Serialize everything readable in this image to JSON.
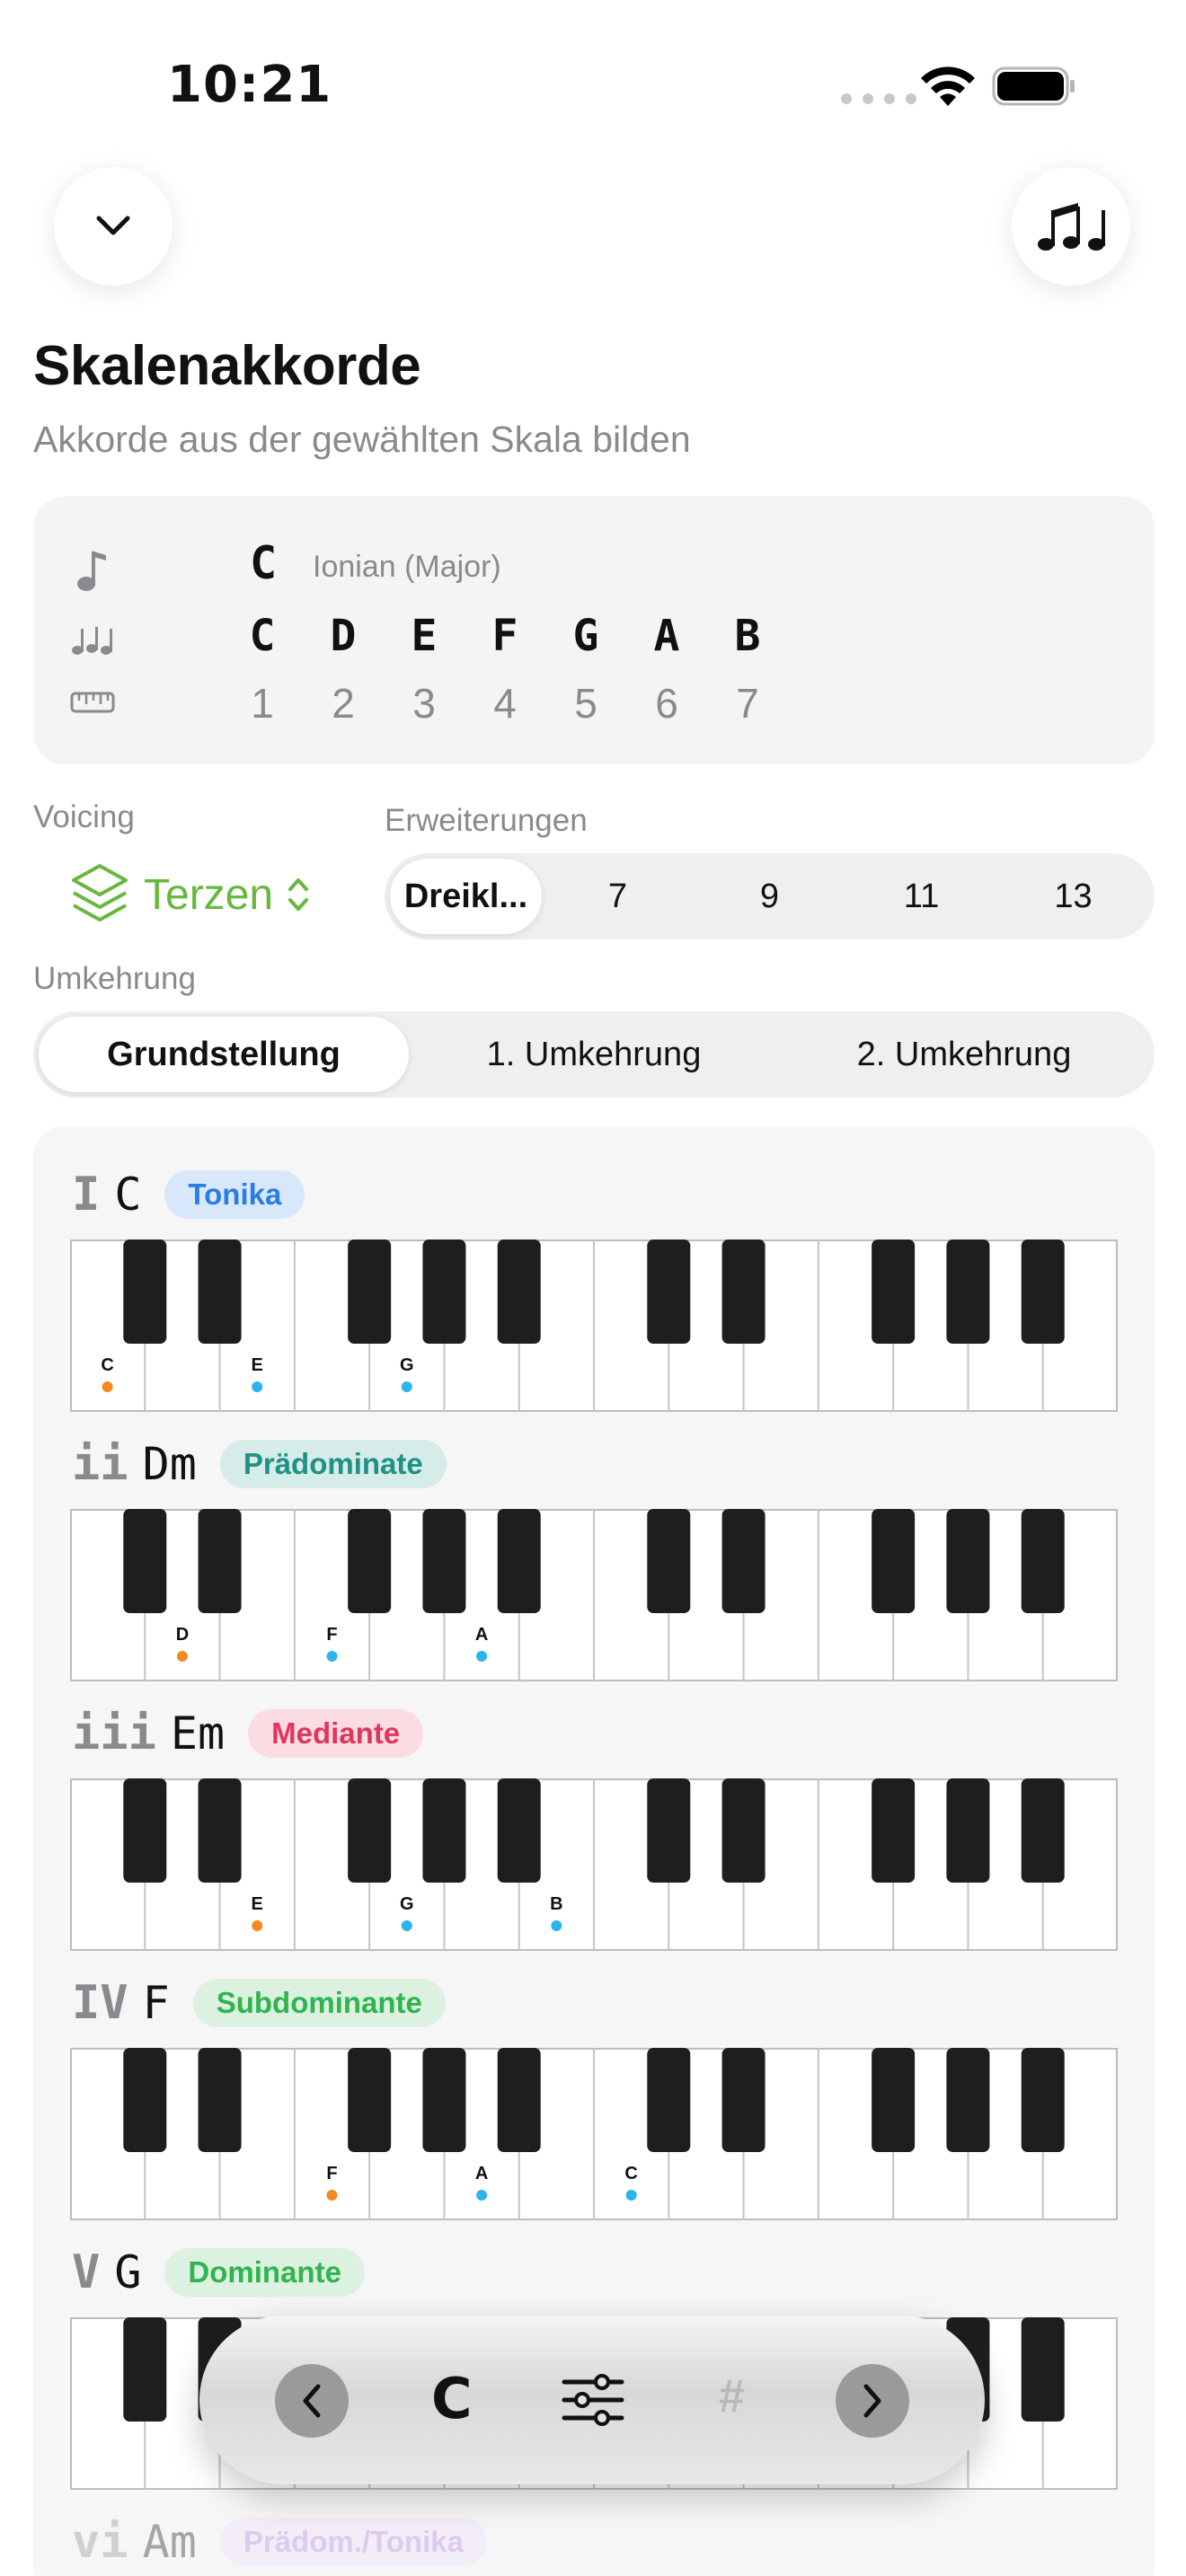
{
  "status": {
    "time": "10:21"
  },
  "header": {
    "title": "Skalenakkorde",
    "subtitle": "Akkorde aus der gewählten Skala bilden"
  },
  "scale": {
    "root": "C",
    "mode": "Ionian (Major)",
    "notes": [
      "C",
      "D",
      "E",
      "F",
      "G",
      "A",
      "B"
    ],
    "degrees": [
      "1",
      "2",
      "3",
      "4",
      "5",
      "6",
      "7"
    ]
  },
  "controls": {
    "voicing_label": "Voicing",
    "voicing_value": "Terzen",
    "extensions_label": "Erweiterungen",
    "extensions": [
      "Dreikl...",
      "7",
      "9",
      "11",
      "13"
    ],
    "extensions_selected": 0,
    "inversion_label": "Umkehrung",
    "inversions": [
      "Grundstellung",
      "1. Umkehrung",
      "2. Umkehrung"
    ],
    "inversion_selected": 0
  },
  "chords": [
    {
      "roman": "I",
      "name": "C",
      "function": "Tonika",
      "badge_bg": "#d9e7fb",
      "badge_fg": "#2a7de1",
      "notes": [
        [
          "C",
          0,
          "root"
        ],
        [
          "E",
          2,
          "tone"
        ],
        [
          "G",
          4,
          "tone"
        ]
      ]
    },
    {
      "roman": "ii",
      "name": "Dm",
      "function": "Prädominate",
      "badge_bg": "#d6ece8",
      "badge_fg": "#1f9186",
      "notes": [
        [
          "D",
          1,
          "root"
        ],
        [
          "F",
          3,
          "tone"
        ],
        [
          "A",
          5,
          "tone"
        ]
      ]
    },
    {
      "roman": "iii",
      "name": "Em",
      "function": "Mediante",
      "badge_bg": "#fadce2",
      "badge_fg": "#e0365a",
      "notes": [
        [
          "E",
          2,
          "root"
        ],
        [
          "G",
          4,
          "tone"
        ],
        [
          "B",
          6,
          "tone"
        ]
      ]
    },
    {
      "roman": "IV",
      "name": "F",
      "function": "Subdominante",
      "badge_bg": "#dcf1df",
      "badge_fg": "#2fb44f",
      "notes": [
        [
          "F",
          3,
          "root"
        ],
        [
          "A",
          5,
          "tone"
        ],
        [
          "C",
          7,
          "tone"
        ]
      ]
    },
    {
      "roman": "V",
      "name": "G",
      "function": "Dominante",
      "badge_bg": "#dcf1df",
      "badge_fg": "#2fb44f",
      "notes": []
    },
    {
      "roman": "vi",
      "name": "Am",
      "function": "Prädom./Tonika",
      "badge_bg": "#ecdff8",
      "badge_fg": "#b07be0",
      "notes": []
    }
  ],
  "toolbar": {
    "key": "C",
    "sharp": "#"
  },
  "colors": {
    "accent_green": "#67b83e",
    "root_dot": "#f28a1f",
    "tone_dot": "#2bb4ef"
  }
}
